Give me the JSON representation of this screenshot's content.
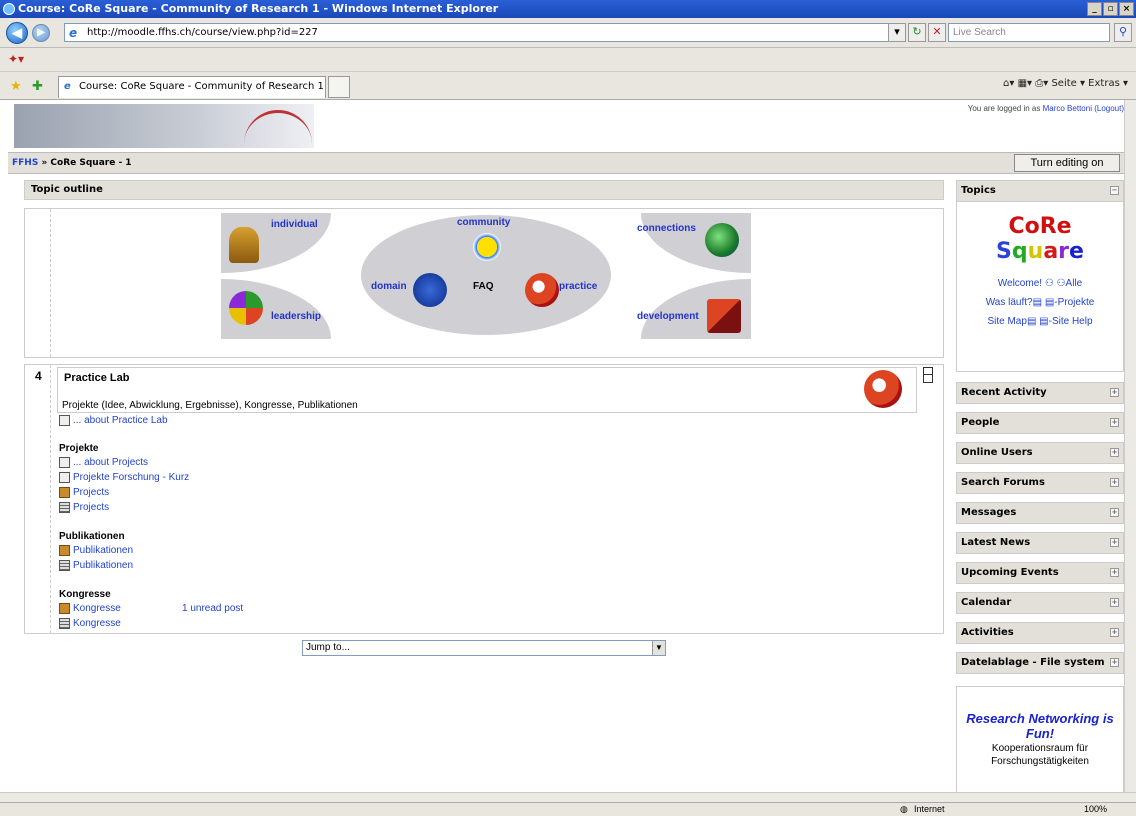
{
  "window": {
    "title": "Course: CoRe Square - Community of Research 1 - Windows Internet Explorer"
  },
  "browser": {
    "url": "http://moodle.ffhs.ch/course/view.php?id=227",
    "search_placeholder": "Live Search",
    "tab_label": "Course: CoRe Square - Community of Research 1",
    "cmd": "Seite ▾  Extras ▾",
    "status_zone": "Internet",
    "zoom": "100%"
  },
  "header": {
    "login_prefix": "You are logged in as",
    "user": "Marco Bettoni",
    "logout": "(Logout)"
  },
  "navbar": {
    "crumb_home": "FFHS",
    "crumb_sep": " » ",
    "crumb_course": "CoRe Square - 1",
    "edit_button": "Turn editing on"
  },
  "outline": {
    "title": "Topic outline"
  },
  "imagemap": {
    "individual": "individual",
    "community": "community",
    "connections": "connections",
    "domain": "domain",
    "faq": "FAQ",
    "practice": "practice",
    "leadership": "leadership",
    "development": "development"
  },
  "section4": {
    "number": "4",
    "title": "Practice Lab",
    "description": "Projekte (Idee, Abwicklung, Ergebnisse), Kongresse, Publikationen",
    "about": "... about Practice Lab",
    "groups": [
      {
        "heading": "Projekte",
        "items": [
          "... about Projects",
          "Projekte Forschung - Kurz",
          "Projects",
          "Projects"
        ]
      },
      {
        "heading": "Publikationen",
        "items": [
          "Publikationen",
          "Publikationen"
        ]
      },
      {
        "heading": "Kongresse",
        "items": [
          "Kongresse",
          "Kongresse"
        ],
        "unread": "1 unread post"
      }
    ]
  },
  "jump": {
    "label": "Jump to..."
  },
  "topics": {
    "title": "Topics",
    "core1": "CoRe",
    "core2_letters": [
      "S",
      "q",
      "u",
      "a",
      "r",
      "e"
    ],
    "core2_colors": [
      "#2a44d6",
      "#22aa22",
      "#d4c400",
      "#d21a1a",
      "#8a2ad6",
      "#1a22cc"
    ],
    "links": [
      [
        "Welcome!",
        "Alle"
      ],
      [
        "Was läuft?",
        "-Projekte"
      ],
      [
        "Site Map",
        "-Site Help"
      ]
    ]
  },
  "blocks": [
    "Recent Activity",
    "People",
    "Online Users",
    "Search Forums",
    "Messages",
    "Latest News",
    "Upcoming Events",
    "Calendar",
    "Activities",
    "Datelablage - File system"
  ],
  "fun": {
    "title": "Research Networking is Fun!",
    "sub1": "Kooperationsraum für",
    "sub2": "Forschungstätigkeiten"
  }
}
